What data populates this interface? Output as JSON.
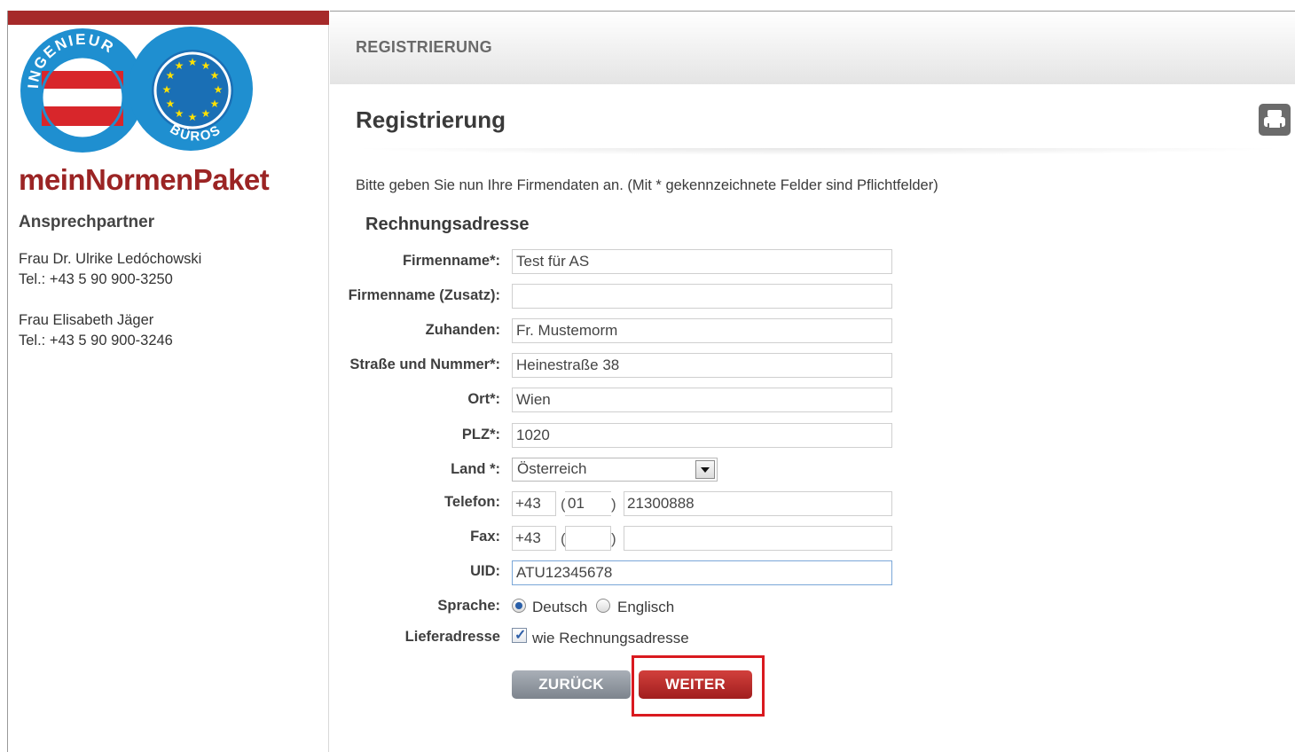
{
  "sidebar": {
    "logo_text_top": "INGENIEUR",
    "logo_text_bottom": "BÜROS",
    "brand": "meinNormenPaket",
    "contact_heading": "Ansprechpartner",
    "contacts": [
      {
        "name": "Frau Dr. Ulrike Ledóchowski",
        "phone": "Tel.: +43 5 90 900-3250"
      },
      {
        "name": "Frau Elisabeth Jäger",
        "phone": "Tel.: +43 5 90 900-3246"
      }
    ]
  },
  "header": {
    "section": "REGISTRIERUNG",
    "page_title": "Registrierung"
  },
  "form": {
    "intro": "Bitte geben Sie nun Ihre Firmendaten an. (Mit * gekennzeichnete Felder sind Pflichtfelder)",
    "section_title": "Rechnungsadresse",
    "labels": {
      "firmenname": "Firmenname*:",
      "firmenname_zusatz": "Firmenname (Zusatz):",
      "zuhanden": "Zuhanden:",
      "strasse": "Straße und Nummer*:",
      "ort": "Ort*:",
      "plz": "PLZ*:",
      "land": "Land *:",
      "telefon": "Telefon:",
      "fax": "Fax:",
      "uid": "UID:",
      "sprache": "Sprache:",
      "lieferadresse": "Lieferadresse"
    },
    "values": {
      "firmenname": "Test für AS",
      "firmenname_zusatz": "",
      "zuhanden": "Fr. Mustemorm",
      "strasse": "Heinestraße 38",
      "ort": "Wien",
      "plz": "1020",
      "land": "Österreich",
      "telefon_country": "+43",
      "telefon_area": "01",
      "telefon_number": "21300888",
      "fax_country": "+43",
      "fax_area": "",
      "fax_number": "",
      "uid": "ATU12345678"
    },
    "paren_open": "(",
    "paren_close": ")",
    "sprache_options": [
      "Deutsch",
      "Englisch"
    ],
    "sprache_selected": "Deutsch",
    "lieferadresse_checkbox_label": "wie Rechnungsadresse",
    "lieferadresse_checked": true
  },
  "buttons": {
    "back": "ZURÜCK",
    "next": "WEITER"
  },
  "colors": {
    "brand_red": "#9b2424",
    "sidebar_bar": "#a62a2a",
    "highlight": "#d9191f",
    "logo_blue": "#1f8fd0"
  }
}
